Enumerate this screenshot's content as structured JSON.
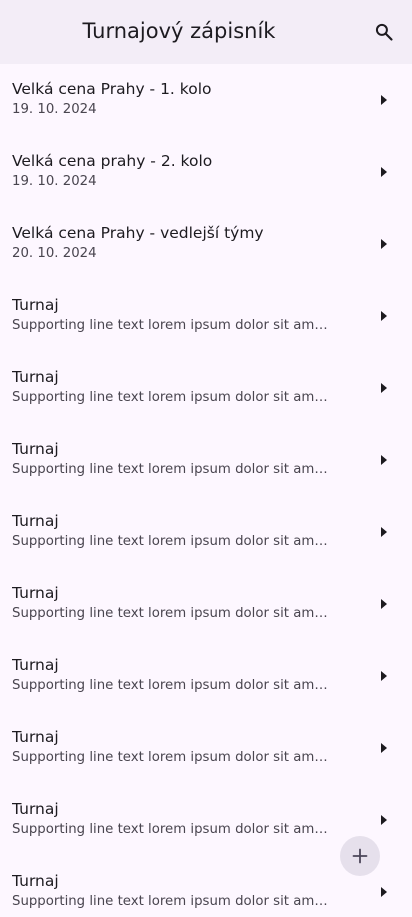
{
  "app_bar": {
    "title": "Turnajový zápisník",
    "search_icon": "search-icon"
  },
  "tournaments": [
    {
      "title": "Velká cena Prahy - 1. kolo",
      "subtitle": "19. 10. 2024"
    },
    {
      "title": "Velká cena prahy - 2. kolo",
      "subtitle": "19. 10. 2024"
    },
    {
      "title": "Velká cena Prahy - vedlejší týmy",
      "subtitle": "20. 10. 2024"
    },
    {
      "title": "Turnaj",
      "subtitle": "Supporting line text lorem ipsum dolor sit amet,..."
    },
    {
      "title": "Turnaj",
      "subtitle": "Supporting line text lorem ipsum dolor sit amet,..."
    },
    {
      "title": "Turnaj",
      "subtitle": "Supporting line text lorem ipsum dolor sit amet,..."
    },
    {
      "title": "Turnaj",
      "subtitle": "Supporting line text lorem ipsum dolor sit amet,..."
    },
    {
      "title": "Turnaj",
      "subtitle": "Supporting line text lorem ipsum dolor sit amet,..."
    },
    {
      "title": "Turnaj",
      "subtitle": "Supporting line text lorem ipsum dolor sit amet,..."
    },
    {
      "title": "Turnaj",
      "subtitle": "Supporting line text lorem ipsum dolor sit amet,..."
    },
    {
      "title": "Turnaj",
      "subtitle": "Supporting line text lorem ipsum dolor sit amet,..."
    },
    {
      "title": "Turnaj",
      "subtitle": "Supporting line text lorem ipsum dolor sit amet,..."
    }
  ],
  "item_trailing_icon": "arrow-right-icon",
  "fab": {
    "icon": "plus-icon",
    "background": "#e6e0ec",
    "icon_color": "#4a4458"
  },
  "colors": {
    "app_bar_bg": "#f3edf7",
    "page_bg": "#fdf7ff",
    "text_primary": "#1d1b20",
    "text_secondary": "#49454f"
  }
}
